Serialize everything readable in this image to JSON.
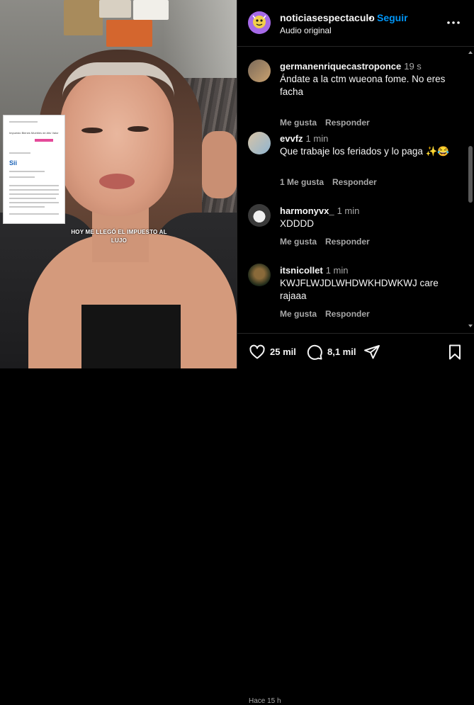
{
  "post": {
    "username": "noticiasespectaculo",
    "separator": "•",
    "follow_label": "Seguir",
    "audio": "Audio original"
  },
  "media": {
    "caption_line1": "HOY ME LLEGÓ EL IMPUESTO AL",
    "caption_line2": "LUJO",
    "doc_title": "Impuesto Bienes Muebles de Alto Valor",
    "doc_logo": "Sii"
  },
  "comments": [
    {
      "user": "germanenriquecastroponce",
      "time": "19 s",
      "text": "Ándate a la ctm wueona fome. No eres facha",
      "likes": "",
      "like_label": "Me gusta",
      "reply_label": "Responder"
    },
    {
      "user": "evvfz",
      "time": "1 min",
      "text": "Que trabaje los feriados y lo paga ✨😂",
      "likes": "1 Me gusta",
      "like_label": "",
      "reply_label": "Responder"
    },
    {
      "user": "harmonyvx_",
      "time": "1 min",
      "text": "XDDDD",
      "likes": "",
      "like_label": "Me gusta",
      "reply_label": "Responder"
    },
    {
      "user": "itsnicollet",
      "time": "1 min",
      "text": "KWJFLWJDLWHDWKHDWKWJ care rajaaa",
      "likes": "",
      "like_label": "Me gusta",
      "reply_label": "Responder"
    }
  ],
  "actions": {
    "likes": "25 mil",
    "comments": "8,1 mil"
  },
  "footer_cut": "Hace 15 h",
  "colors": {
    "accent": "#0095f6",
    "muted": "#a8a8a8",
    "bg": "#000000"
  }
}
